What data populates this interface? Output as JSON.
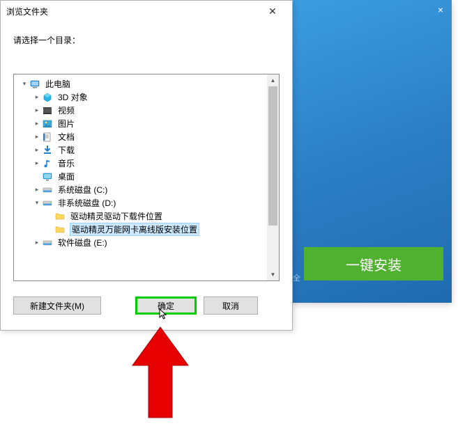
{
  "backdrop": {
    "install_button": "一键安装",
    "security_hint": "全"
  },
  "dialog": {
    "title": "浏览文件夹",
    "prompt": "请选择一个目录：",
    "buttons": {
      "new_folder": "新建文件夹(M)",
      "ok": "确定",
      "cancel": "取消"
    }
  },
  "tree": [
    {
      "id": "this-pc",
      "label": "此电脑",
      "icon": "pc",
      "level": 0,
      "expand": "open"
    },
    {
      "id": "3d-objects",
      "label": "3D 对象",
      "icon": "3d",
      "level": 1,
      "expand": "closed"
    },
    {
      "id": "videos",
      "label": "视频",
      "icon": "video",
      "level": 1,
      "expand": "closed"
    },
    {
      "id": "pictures",
      "label": "图片",
      "icon": "pic",
      "level": 1,
      "expand": "closed"
    },
    {
      "id": "documents",
      "label": "文档",
      "icon": "doc",
      "level": 1,
      "expand": "closed"
    },
    {
      "id": "downloads",
      "label": "下载",
      "icon": "download",
      "level": 1,
      "expand": "closed"
    },
    {
      "id": "music",
      "label": "音乐",
      "icon": "music",
      "level": 1,
      "expand": "closed"
    },
    {
      "id": "desktop",
      "label": "桌面",
      "icon": "desktop",
      "level": 1,
      "expand": "none"
    },
    {
      "id": "drive-c",
      "label": "系统磁盘 (C:)",
      "icon": "drive",
      "level": 1,
      "expand": "closed"
    },
    {
      "id": "drive-d",
      "label": "非系统磁盘 (D:)",
      "icon": "drive",
      "level": 1,
      "expand": "open"
    },
    {
      "id": "folder-dl",
      "label": "驱动精灵驱动下载件位置",
      "icon": "folder",
      "level": 2,
      "expand": "none"
    },
    {
      "id": "folder-install",
      "label": "驱动精灵万能网卡离线版安装位置",
      "icon": "folder",
      "level": 2,
      "expand": "none",
      "selected": true
    },
    {
      "id": "drive-e",
      "label": "软件磁盘 (E:)",
      "icon": "drive",
      "level": 1,
      "expand": "closed"
    }
  ]
}
